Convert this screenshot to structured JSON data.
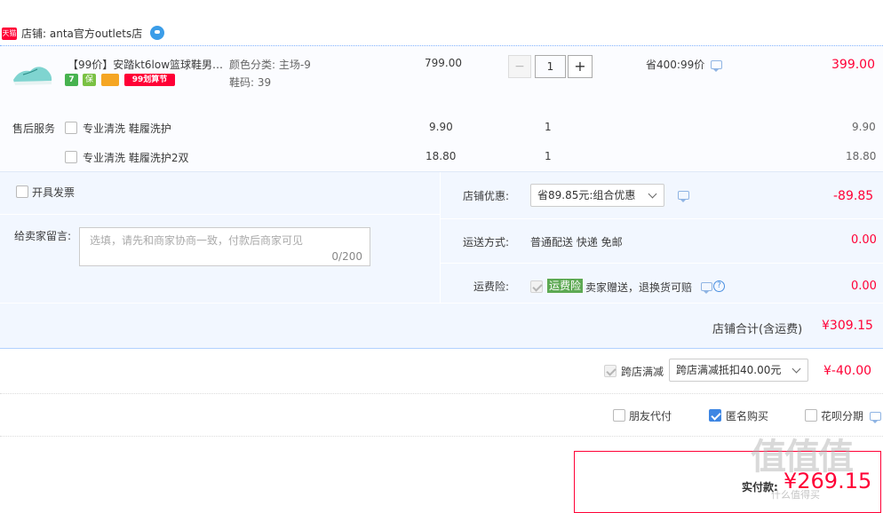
{
  "shop": {
    "platform_badge": "天猫",
    "label": "店铺: anta官方outlets店"
  },
  "product": {
    "title": "【99价】安踏kt6low篮球鞋男…",
    "badges": {
      "seven": "7",
      "bao": "保",
      "card": "",
      "festival": "99划算节"
    },
    "attr_color": "颜色分类: 主场-9",
    "attr_size": "鞋码: 39",
    "unit_price": "799.00",
    "qty": "1",
    "minus": "−",
    "plus": "+",
    "discount": "省400:99价",
    "subtotal": "399.00"
  },
  "after_sales": {
    "label": "售后服务",
    "items": [
      {
        "name": "专业清洗 鞋履洗护",
        "price": "9.90",
        "qty": "1",
        "total": "9.90"
      },
      {
        "name": "专业清洗 鞋履洗护2双",
        "price": "18.80",
        "qty": "1",
        "total": "18.80"
      }
    ]
  },
  "invoice": {
    "label": "开具发票"
  },
  "note": {
    "label": "给卖家留言:",
    "placeholder": "选填，请先和商家协商一致，付款后商家可见",
    "counter": "0/200"
  },
  "shop_discount": {
    "label": "店铺优惠:",
    "selected": "省89.85元:组合优惠",
    "amount": "-89.85"
  },
  "shipping": {
    "label": "运送方式:",
    "method": "普通配送 快递 免邮",
    "amount": "0.00"
  },
  "insurance": {
    "label": "运费险:",
    "tag": "运费险",
    "text": "卖家赠送，退换货可赔",
    "help": "?",
    "amount": "0.00"
  },
  "shop_total": {
    "label": "店铺合计(含运费)",
    "amount": "¥309.15"
  },
  "cross_store": {
    "label": "跨店满减",
    "selected": "跨店满减抵扣40.00元",
    "amount": "¥-40.00"
  },
  "pay_options": {
    "friend": "朋友代付",
    "anonymous": "匿名购买",
    "huabei": "花呗分期"
  },
  "final": {
    "label": "实付款:",
    "amount": "¥269.15"
  },
  "watermark": {
    "text": "值值值",
    "site": "什么值得买"
  },
  "colors": {
    "accent_red": "#ff0036",
    "panel_blue": "#f2f7ff",
    "divider": "#b2d1ff",
    "tag_green": "#5da953"
  }
}
